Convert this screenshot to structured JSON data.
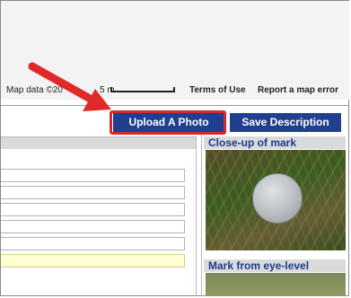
{
  "map": {
    "map_data_label": "Map data ©20",
    "scale_label": "5 m",
    "terms_label": "Terms of Use",
    "report_label": "Report a map error"
  },
  "toolbar": {
    "upload_label": "Upload A Photo",
    "save_label": "Save Description"
  },
  "photos": {
    "closeup_title": "Close-up of mark",
    "eye_level_title": "Mark from eye-level"
  },
  "colors": {
    "button_bg": "#213f8f",
    "highlight_border": "#d7262e",
    "panel_title": "#1c3b8c"
  }
}
